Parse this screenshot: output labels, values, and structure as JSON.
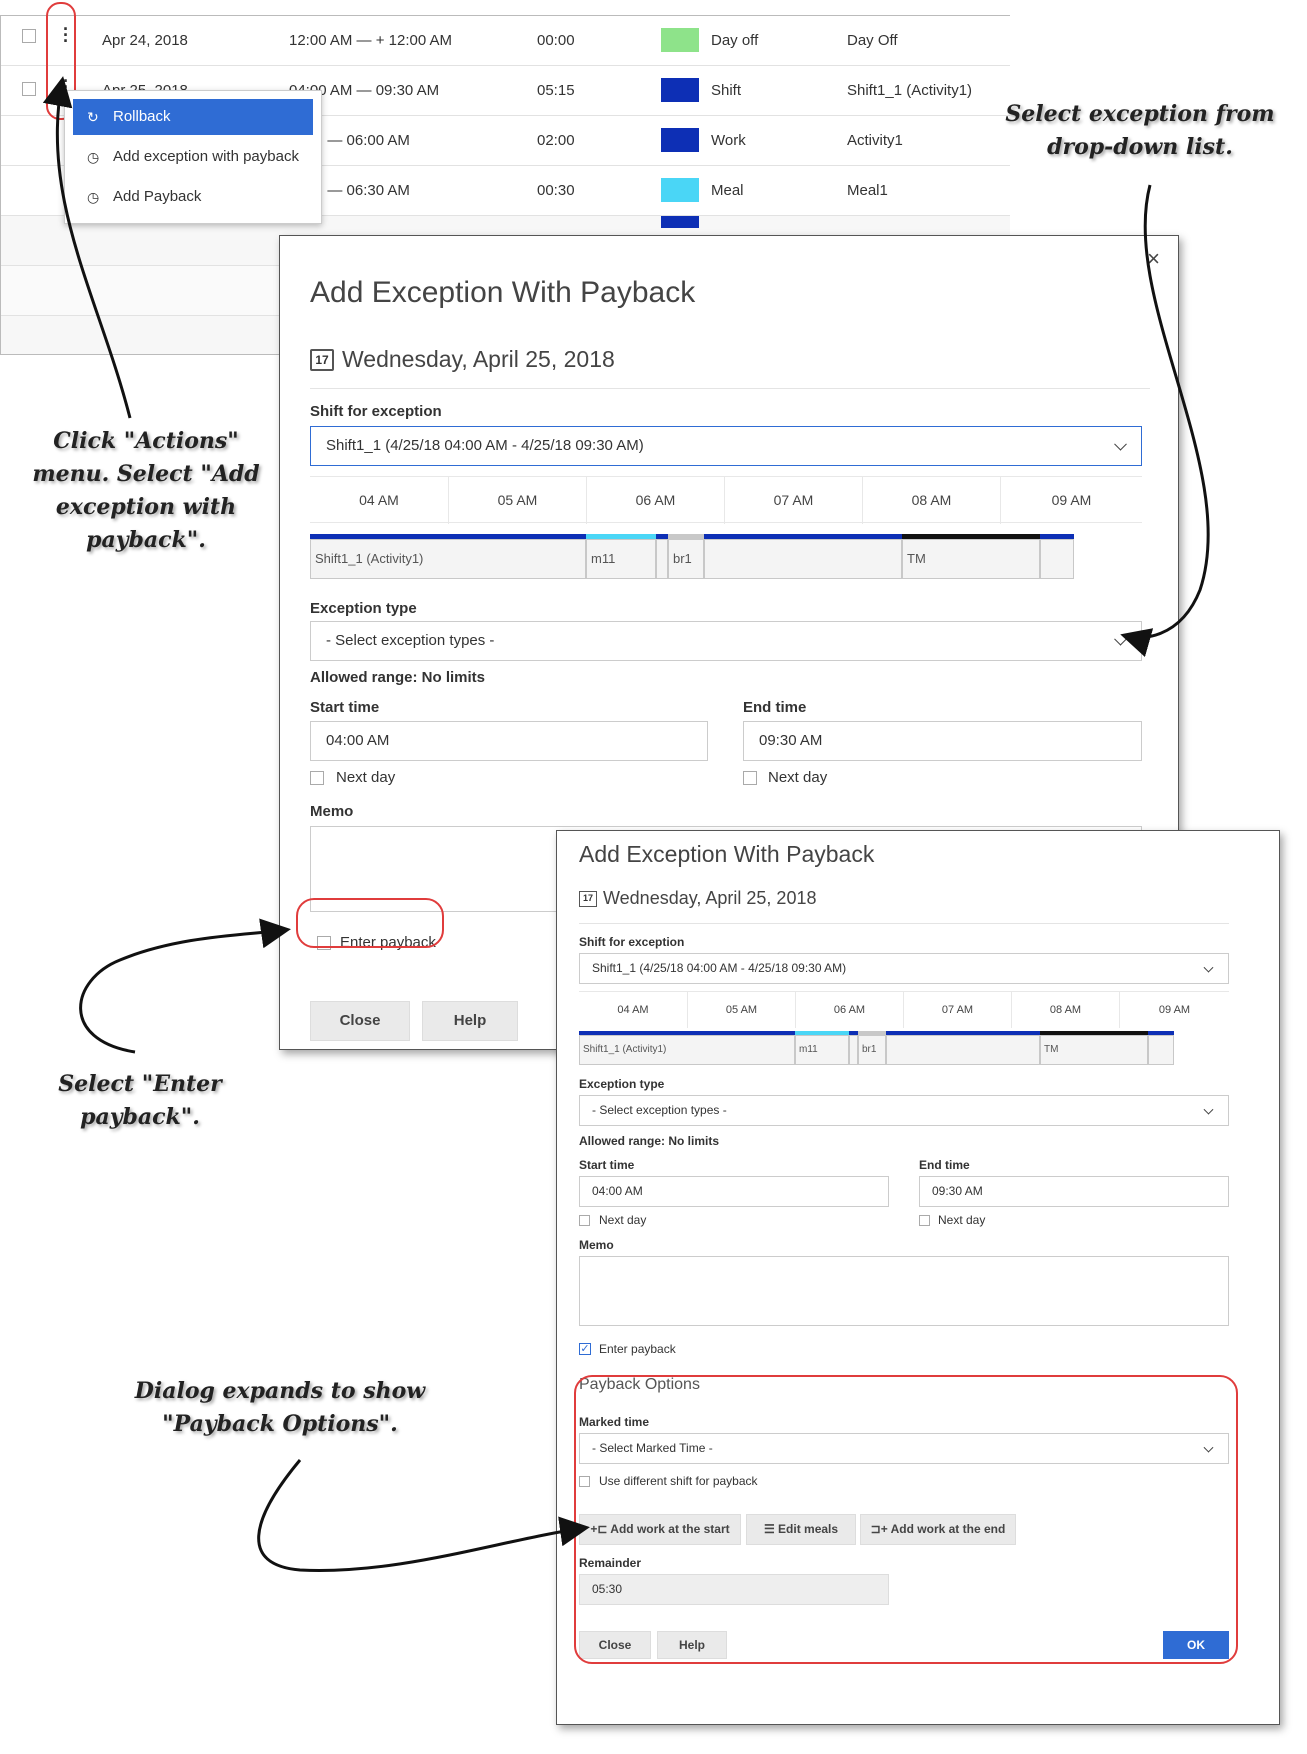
{
  "table": {
    "rows": [
      {
        "date": "Apr 24, 2018",
        "time": "12:00 AM — + 12:00 AM",
        "duration": "00:00",
        "type": "Day off",
        "name": "Day Off",
        "color": "#8ee38a"
      },
      {
        "date": "Apr 25, 2018",
        "time": "04:00 AM — 09:30 AM",
        "duration": "05:15",
        "type": "Shift",
        "name": "Shift1_1 (Activity1)",
        "color": "#0d2fb5"
      },
      {
        "date": "",
        "time": "0 AM — 06:00 AM",
        "duration": "02:00",
        "type": "Work",
        "name": "Activity1",
        "color": "#0d2fb5"
      },
      {
        "date": "",
        "time": "0 AM — 06:30 AM",
        "duration": "00:30",
        "type": "Meal",
        "name": "Meal1",
        "color": "#4ad6f6"
      }
    ]
  },
  "actions_menu": {
    "items": [
      {
        "label": "Rollback",
        "icon": "rollback-icon"
      },
      {
        "label": "Add exception with payback",
        "icon": "clock-icon"
      },
      {
        "label": "Add Payback",
        "icon": "clock-icon"
      }
    ]
  },
  "dialog1": {
    "title": "Add Exception With Payback",
    "date": "Wednesday, April 25, 2018",
    "shift_label": "Shift for exception",
    "shift_value": "Shift1_1 (4/25/18 04:00 AM - 4/25/18 09:30 AM)",
    "hours": [
      "04 AM",
      "05 AM",
      "06 AM",
      "07 AM",
      "08 AM",
      "09 AM"
    ],
    "segments": [
      "Shift1_1 (Activity1)",
      "m11",
      "br1",
      "",
      "TM",
      ""
    ],
    "exception_label": "Exception type",
    "exception_placeholder": "- Select exception types -",
    "allowed_range": "Allowed range: No limits",
    "start_label": "Start time",
    "start_value": "04:00 AM",
    "end_label": "End time",
    "end_value": "09:30 AM",
    "next_day": "Next day",
    "memo_label": "Memo",
    "payback_label": "Enter payback",
    "close": "Close",
    "help": "Help",
    "close_x": "×"
  },
  "dialog2": {
    "title": "Add Exception With Payback",
    "date": "Wednesday, April 25, 2018",
    "shift_label": "Shift for exception",
    "shift_value": "Shift1_1 (4/25/18 04:00 AM - 4/25/18 09:30 AM)",
    "hours": [
      "04 AM",
      "05 AM",
      "06 AM",
      "07 AM",
      "08 AM",
      "09 AM"
    ],
    "segments": [
      "Shift1_1 (Activity1)",
      "m11",
      "br1",
      "",
      "TM",
      ""
    ],
    "exception_label": "Exception type",
    "exception_placeholder": "- Select exception types -",
    "allowed_range": "Allowed range: No limits",
    "start_label": "Start time",
    "start_value": "04:00 AM",
    "end_label": "End time",
    "end_value": "09:30 AM",
    "next_day": "Next day",
    "memo_label": "Memo",
    "payback_label": "Enter payback",
    "payback_options_title": "Payback Options",
    "marked_time_label": "Marked time",
    "marked_time_placeholder": "- Select Marked Time -",
    "use_diff_shift": "Use different shift for payback",
    "btn_add_start": "Add work at the start",
    "btn_edit_meals": "Edit meals",
    "btn_add_end": "Add work at the end",
    "remainder_label": "Remainder",
    "remainder_value": "05:30",
    "close": "Close",
    "help": "Help",
    "ok": "OK"
  },
  "annotations": {
    "actions": "Click \"Actions\" menu. Select \"Add exception with payback\".",
    "dropdown": "Select exception from drop-down list.",
    "payback": "Select \"Enter payback\".",
    "expands": "Dialog expands to show \"Payback Options\"."
  },
  "colors": {
    "primary": "#2f6cd4",
    "timeline_blue": "#0d2fb5",
    "meal_cyan": "#4ad6f6",
    "break_gray": "#c8c8c8",
    "annotation_red": "#e03c3c"
  }
}
